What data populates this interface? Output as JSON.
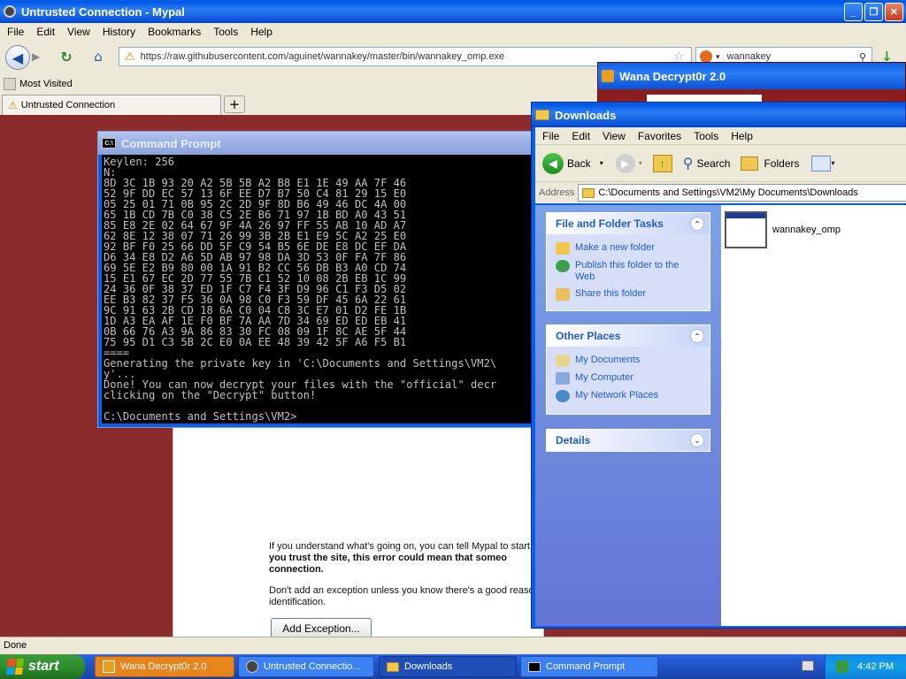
{
  "browser": {
    "title": "Untrusted Connection - Mypal",
    "menu": [
      "File",
      "Edit",
      "View",
      "History",
      "Bookmarks",
      "Tools",
      "Help"
    ],
    "url": "https://raw.githubusercontent.com/aguinet/wannakey/master/bin/wannakey_omp.exe",
    "search_value": "wannakey",
    "bookmark": "Most Visited",
    "tab_title": "Untrusted Connection",
    "error_text_1": "If you understand what's going on, you can tell Mypal to start",
    "error_text_2": "you trust the site, this error could mean that someo",
    "error_text_3": "connection.",
    "error_text_4": "Don't add an exception unless you know there's a good reaso",
    "error_text_5": "identification.",
    "add_exception_label": "Add Exception...",
    "status": "Done"
  },
  "cmd": {
    "title": "Command Prompt",
    "output": "Keylen: 256\nN:\n8D 3C 1B 93 20 A2 5B 5B A2 B8 E1 1E 49 AA 7F 46\n52 9F DD EC 57 13 6F EE D7 B7 50 C4 81 29 15 E0\n05 25 01 71 0B 95 2C 2D 9F 8D B6 49 46 DC 4A 00\n65 1B CD 7B C0 38 C5 2E B6 71 97 1B BD A0 43 51\n85 E8 2E 02 64 67 9F 4A 26 97 FF 55 AB 10 AD A7\n62 8E 12 38 07 71 26 99 3B 2B E1 E9 5C A2 25 E0\n92 BF F0 25 66 DD 5F C9 54 B5 6E DE E8 DC EF DA\nD6 34 E8 D2 A6 5D AB 97 98 DA 3D 53 0F FA 7F 86\n69 5E E2 B9 80 00 1A 91 B2 CC 56 DB B3 A0 CD 74\n15 E1 67 EC 2D 77 55 7B C1 52 10 08 2B EB 1C 99\n24 36 0F 38 37 ED 1F C7 F4 3F D9 96 C1 F3 D5 02\nEE B3 82 37 F5 36 0A 98 C0 F3 59 DF 45 6A 22 61\n9C 91 63 2B CD 18 6A C0 04 C8 3C E7 01 D2 FE 1B\n1D A3 EA AF 1E F0 BF 7A AA 7D 34 69 ED ED EB 41\n0B 66 76 A3 9A 86 83 30 FC 08 09 1F 8C AE 5F 44\n75 95 D1 C3 5B 2C E0 0A EE 48 39 42 5F A6 F5 B1\n====\nGenerating the private key in 'C:\\Documents and Settings\\VM2\\\ny'...\nDone! You can now decrypt your files with the \"official\" decr\nclicking on the \"Decrypt\" button!\n\nC:\\Documents and Settings\\VM2>"
  },
  "wana": {
    "title": "Wana Decrypt0r 2.0"
  },
  "explorer": {
    "title": "Downloads",
    "menu": [
      "File",
      "Edit",
      "View",
      "Favorites",
      "Tools",
      "Help"
    ],
    "back_label": "Back",
    "search_label": "Search",
    "folders_label": "Folders",
    "address_label": "Address",
    "address_value": "C:\\Documents and Settings\\VM2\\My Documents\\Downloads",
    "tasks_title": "File and Folder Tasks",
    "tasks": [
      "Make a new folder",
      "Publish this folder to the Web",
      "Share this folder"
    ],
    "places_title": "Other Places",
    "places": [
      "My Documents",
      "My Computer",
      "My Network Places"
    ],
    "details_title": "Details",
    "file_name": "wannakey_omp"
  },
  "taskbar": {
    "start_label": "start",
    "buttons": [
      "Wana Decrypt0r 2.0",
      "Untrusted Connectio...",
      "Downloads",
      "Command Prompt"
    ],
    "clock": "4:42 PM"
  },
  "colors": {
    "xp_blue": "#0a5fe8",
    "error_bg": "#8c2b2b",
    "wana_red": "#8b1d1d",
    "taskbar_blue": "#245edb",
    "start_green": "#2f8f2f"
  }
}
